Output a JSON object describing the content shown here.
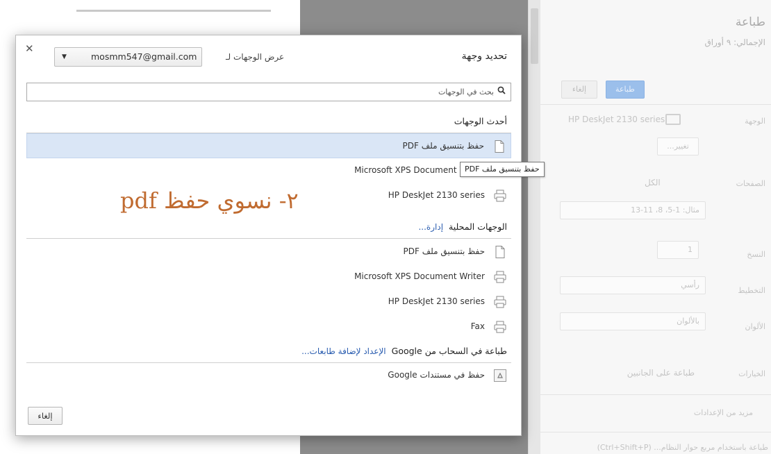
{
  "preview": {
    "line_count": 16
  },
  "settings": {
    "title": "طباعة",
    "subtitle": "الإجمالي: ٩ أوراق",
    "print_button": "طباعة",
    "cancel_button": "إلغاء",
    "destination_label": "الوجهة",
    "destination_value": "HP DeskJet 2130 series",
    "change_button": "تغيير...",
    "pages_label": "الصفحات",
    "pages_all": "الكل",
    "pages_example": "مثال: 1-5، 8، 11-13",
    "copies_label": "النسخ",
    "copies_value": "1",
    "layout_label": "التخطيط",
    "layout_value": "رأسي",
    "color_label": "الألوان",
    "color_value": "بالألوان",
    "options_label": "الخيارات",
    "options_two_sided": "طباعة على الجانبين",
    "more_settings": "مزيد من الإعدادات",
    "system_dialog": "طباعة باستخدام مربع حوار النظام... (Ctrl+Shift+P)"
  },
  "tooltip": "حفظ بتنسيق ملف PDF",
  "dialog": {
    "title": "تحديد وجهة",
    "account_label": "عرض الوجهات لـ",
    "account_value": "mosmm547@gmail.com",
    "search_placeholder": "بحث في الوجهات",
    "recent": {
      "title": "أحدث الوجهات",
      "items": [
        {
          "label": "حفظ بتنسيق ملف PDF",
          "icon": "pdf-icon"
        },
        {
          "label": "Microsoft XPS Document Writer",
          "icon": "printer-icon"
        },
        {
          "label": "HP DeskJet 2130 series",
          "icon": "printer-icon"
        }
      ]
    },
    "local": {
      "title": "الوجهات المحلية",
      "manage_link": "إدارة...",
      "items": [
        {
          "label": "حفظ بتنسيق ملف PDF",
          "icon": "pdf-icon"
        },
        {
          "label": "Microsoft XPS Document Writer",
          "icon": "printer-icon"
        },
        {
          "label": "HP DeskJet 2130 series",
          "icon": "printer-icon"
        },
        {
          "label": "Fax",
          "icon": "printer-icon"
        }
      ]
    },
    "cloud": {
      "title": "طباعة في السحاب من Google",
      "setup_link": "الإعداد لإضافة طابعات...",
      "items": [
        {
          "label": "حفظ في مستندات Google",
          "icon": "google-drive-icon"
        }
      ]
    },
    "annotation": "٢- نسوي حفظ pdf",
    "cancel_button": "إلغاء"
  },
  "colors": {
    "selected_row": "#dae6f6",
    "link": "#2a5db0",
    "annotation": "#c06b30",
    "print_button": "#9bbfeb"
  }
}
